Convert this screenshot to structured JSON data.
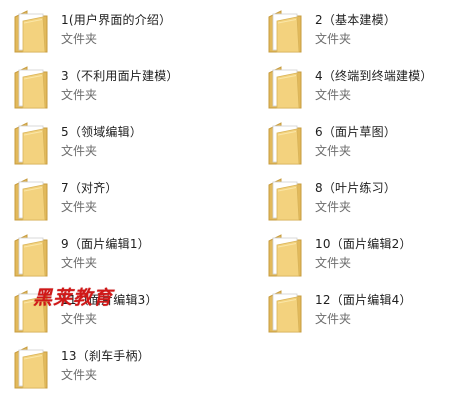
{
  "folders": [
    {
      "name": "1(用户界面的介绍）",
      "type": "文件夹",
      "icon": "folder-icon"
    },
    {
      "name": "2（基本建模）",
      "type": "文件夹",
      "icon": "folder-icon"
    },
    {
      "name": "3（不利用面片建模）",
      "type": "文件夹",
      "icon": "folder-icon"
    },
    {
      "name": "4（终端到终端建模）",
      "type": "文件夹",
      "icon": "folder-icon"
    },
    {
      "name": "5（领域编辑）",
      "type": "文件夹",
      "icon": "folder-icon"
    },
    {
      "name": "6（面片草图）",
      "type": "文件夹",
      "icon": "folder-icon"
    },
    {
      "name": "7（对齐）",
      "type": "文件夹",
      "icon": "folder-icon"
    },
    {
      "name": "8（叶片练习）",
      "type": "文件夹",
      "icon": "folder-icon"
    },
    {
      "name": "9（面片编辑1）",
      "type": "文件夹",
      "icon": "folder-icon"
    },
    {
      "name": "10（面片编辑2）",
      "type": "文件夹",
      "icon": "folder-icon"
    },
    {
      "name": "11（面片编辑3）",
      "type": "文件夹",
      "icon": "folder-icon"
    },
    {
      "name": "12（面片编辑4）",
      "type": "文件夹",
      "icon": "folder-icon"
    },
    {
      "name": "13（刹车手柄）",
      "type": "文件夹",
      "icon": "folder-icon"
    }
  ],
  "watermark": {
    "text": "黑莱教育",
    "color": "#d01818"
  },
  "colors": {
    "folder_body": "#f3d27e",
    "folder_back": "#e2b95b",
    "disc_accent": "#1f8fb6"
  }
}
